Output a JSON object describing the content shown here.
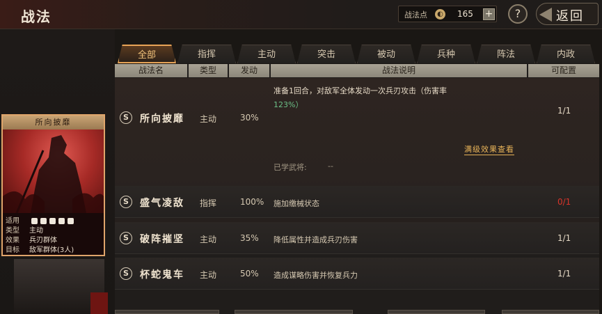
{
  "header": {
    "title": "战法",
    "points_label": "战法点",
    "points_icon": "coin-icon",
    "points_value": "165",
    "add_label": "+",
    "help_label": "?",
    "back_label": "返回"
  },
  "tabs": [
    {
      "label": "全部",
      "active": true
    },
    {
      "label": "指挥",
      "active": false
    },
    {
      "label": "主动",
      "active": false
    },
    {
      "label": "突击",
      "active": false
    },
    {
      "label": "被动",
      "active": false
    },
    {
      "label": "兵种",
      "active": false
    },
    {
      "label": "阵法",
      "active": false
    },
    {
      "label": "内政",
      "active": false
    }
  ],
  "table": {
    "headers": [
      "战法名",
      "类型",
      "发动",
      "战法说明",
      "可配置"
    ]
  },
  "selected_skill": {
    "badge": "S",
    "name": "所向披靡",
    "type": "主动",
    "rate": "30%",
    "desc_line1": "准备1回合，对敌军全体发动一次兵刃攻击（伤害率",
    "desc_line2": "123%）",
    "detail_link": "满级效果查看",
    "learned_label": "已学武将:",
    "learned_value": "--",
    "available": "1/1"
  },
  "skills": [
    {
      "badge": "S",
      "name": "盛气凌敌",
      "type": "指挥",
      "rate": "100%",
      "desc": "施加缴械状态",
      "available": "0/1",
      "available_color": "#d8342a"
    },
    {
      "badge": "S",
      "name": "破阵摧坚",
      "type": "主动",
      "rate": "35%",
      "desc": "降低属性并造成兵刃伤害",
      "available": "1/1"
    },
    {
      "badge": "S",
      "name": "杯蛇鬼车",
      "type": "主动",
      "rate": "50%",
      "desc": "造成谋略伤害并恢复兵力",
      "available": "1/1"
    }
  ],
  "card": {
    "title": "所向披靡",
    "troops_label": "适用",
    "troop_icons": [
      "cavalry-icon",
      "shield-icon",
      "bow-icon",
      "spear-icon",
      "siege-icon"
    ],
    "type_label": "类型",
    "type_value": "主动",
    "effect_label": "效果",
    "effect_value": "兵刃群体",
    "target_label": "目标",
    "target_value": "敌军群体(3人)"
  }
}
